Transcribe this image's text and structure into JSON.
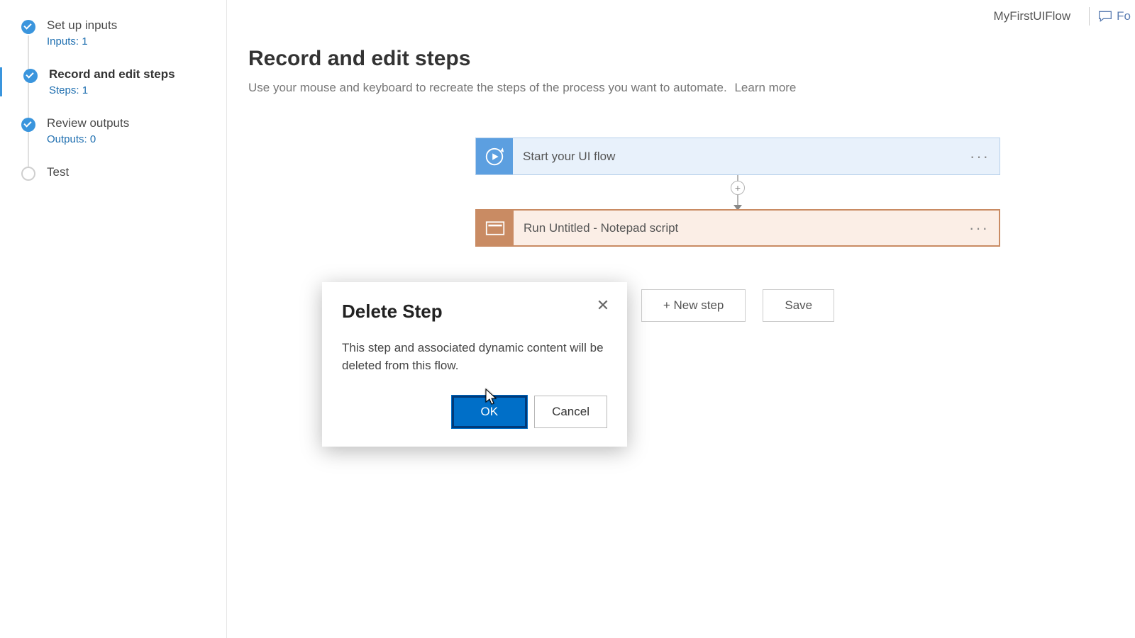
{
  "header": {
    "flowName": "MyFirstUIFlow",
    "feedback": "Fo"
  },
  "nav": {
    "items": [
      {
        "title": "Set up inputs",
        "sub": "Inputs: 1",
        "state": "done"
      },
      {
        "title": "Record and edit steps",
        "sub": "Steps: 1",
        "state": "done",
        "active": true
      },
      {
        "title": "Review outputs",
        "sub": "Outputs: 0",
        "state": "done"
      },
      {
        "title": "Test",
        "sub": "",
        "state": "pending"
      }
    ]
  },
  "page": {
    "title": "Record and edit steps",
    "description": "Use your mouse and keyboard to recreate the steps of the process you want to automate.",
    "learnMore": "Learn more"
  },
  "steps": {
    "start": {
      "label": "Start your UI flow"
    },
    "run": {
      "label": "Run Untitled - Notepad script"
    }
  },
  "actions": {
    "newStep": "+ New step",
    "save": "Save"
  },
  "dialog": {
    "title": "Delete Step",
    "body": "This step and associated dynamic content will be deleted from this flow.",
    "ok": "OK",
    "cancel": "Cancel"
  }
}
